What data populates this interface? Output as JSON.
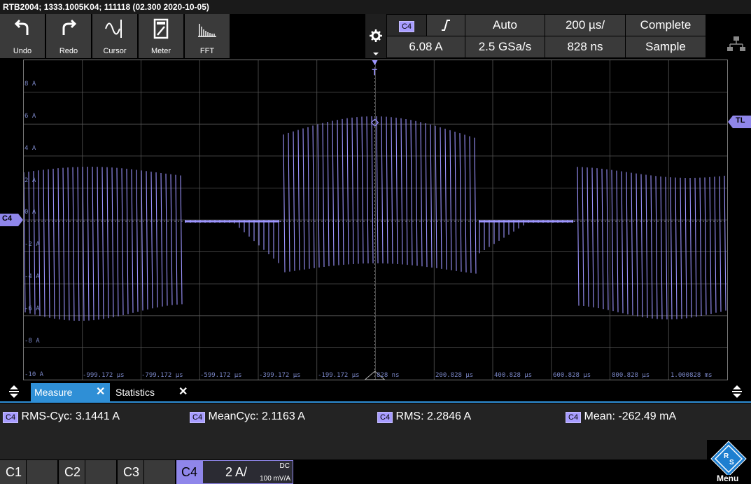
{
  "title": "RTB2004; 1333.1005K04; 111118 (02.300 2020-10-05)",
  "toolbar": {
    "undo": "Undo",
    "redo": "Redo",
    "cursor": "Cursor",
    "meter": "Meter",
    "fft": "FFT"
  },
  "trigger": {
    "channel": "C4",
    "slope_icon": "rising-edge-icon",
    "mode": "Auto",
    "timebase": "200 µs/",
    "acq": "Complete",
    "level": "6.08 A",
    "sample_rate": "2.5 GSa/s",
    "offset": "828 ns",
    "acq_mode": "Sample"
  },
  "y_labels": [
    "8 A",
    "6 A",
    "4 A",
    "2 A",
    "0 A",
    "-2 A",
    "-4 A",
    "-6 A",
    "-8 A",
    "-10 A"
  ],
  "x_labels": [
    "-999.172 µs",
    "-799.172 µs",
    "-599.172 µs",
    "-399.172 µs",
    "-199.172 µs",
    "828 ns",
    "200.828 µs",
    "400.828 µs",
    "600.828 µs",
    "800.828 µs",
    "1.000828 ms"
  ],
  "markers": {
    "channel": "C4",
    "trigger_level": "TL",
    "trigger_pos": "T"
  },
  "tabs": {
    "measure": "Measure",
    "statistics": "Statistics"
  },
  "measurements": [
    {
      "ch": "C4",
      "text": "RMS-Cyc: 3.1441 A"
    },
    {
      "ch": "C4",
      "text": "MeanCyc: 2.1163 A"
    },
    {
      "ch": "C4",
      "text": "RMS: 2.2846 A"
    },
    {
      "ch": "C4",
      "text": "Mean: -262.49 mA"
    }
  ],
  "channels": {
    "c1": "C1",
    "c2": "C2",
    "c3": "C3",
    "c4": "C4",
    "c4_scale": "2 A/",
    "c4_coupling": "DC",
    "c4_probe": "100 mV/A"
  },
  "menu": "Menu",
  "colors": {
    "trace": "#9d95ff",
    "accent": "#2f8fd6",
    "grid": "#555555"
  }
}
